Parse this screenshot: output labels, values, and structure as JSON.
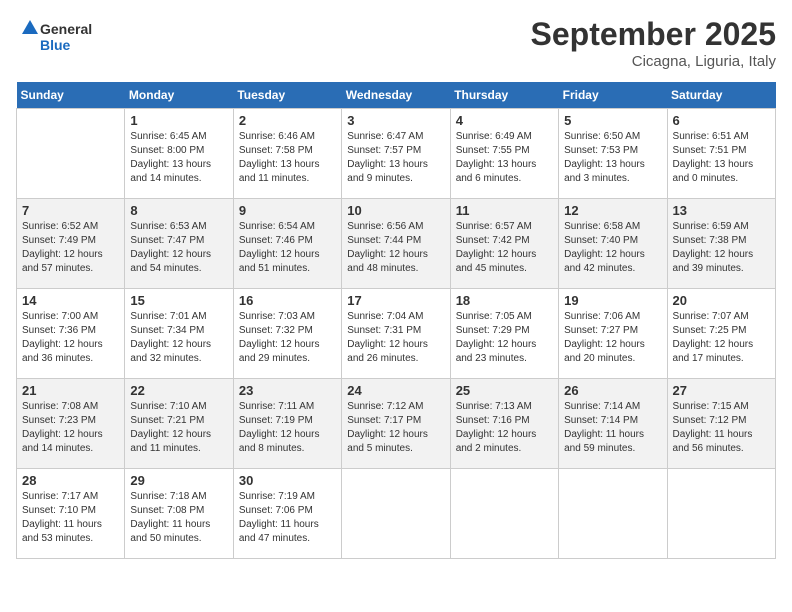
{
  "header": {
    "logo_line1": "General",
    "logo_line2": "Blue",
    "month": "September 2025",
    "location": "Cicagna, Liguria, Italy"
  },
  "weekdays": [
    "Sunday",
    "Monday",
    "Tuesday",
    "Wednesday",
    "Thursday",
    "Friday",
    "Saturday"
  ],
  "weeks": [
    [
      {
        "day": "",
        "info": ""
      },
      {
        "day": "1",
        "info": "Sunrise: 6:45 AM\nSunset: 8:00 PM\nDaylight: 13 hours\nand 14 minutes."
      },
      {
        "day": "2",
        "info": "Sunrise: 6:46 AM\nSunset: 7:58 PM\nDaylight: 13 hours\nand 11 minutes."
      },
      {
        "day": "3",
        "info": "Sunrise: 6:47 AM\nSunset: 7:57 PM\nDaylight: 13 hours\nand 9 minutes."
      },
      {
        "day": "4",
        "info": "Sunrise: 6:49 AM\nSunset: 7:55 PM\nDaylight: 13 hours\nand 6 minutes."
      },
      {
        "day": "5",
        "info": "Sunrise: 6:50 AM\nSunset: 7:53 PM\nDaylight: 13 hours\nand 3 minutes."
      },
      {
        "day": "6",
        "info": "Sunrise: 6:51 AM\nSunset: 7:51 PM\nDaylight: 13 hours\nand 0 minutes."
      }
    ],
    [
      {
        "day": "7",
        "info": "Sunrise: 6:52 AM\nSunset: 7:49 PM\nDaylight: 12 hours\nand 57 minutes."
      },
      {
        "day": "8",
        "info": "Sunrise: 6:53 AM\nSunset: 7:47 PM\nDaylight: 12 hours\nand 54 minutes."
      },
      {
        "day": "9",
        "info": "Sunrise: 6:54 AM\nSunset: 7:46 PM\nDaylight: 12 hours\nand 51 minutes."
      },
      {
        "day": "10",
        "info": "Sunrise: 6:56 AM\nSunset: 7:44 PM\nDaylight: 12 hours\nand 48 minutes."
      },
      {
        "day": "11",
        "info": "Sunrise: 6:57 AM\nSunset: 7:42 PM\nDaylight: 12 hours\nand 45 minutes."
      },
      {
        "day": "12",
        "info": "Sunrise: 6:58 AM\nSunset: 7:40 PM\nDaylight: 12 hours\nand 42 minutes."
      },
      {
        "day": "13",
        "info": "Sunrise: 6:59 AM\nSunset: 7:38 PM\nDaylight: 12 hours\nand 39 minutes."
      }
    ],
    [
      {
        "day": "14",
        "info": "Sunrise: 7:00 AM\nSunset: 7:36 PM\nDaylight: 12 hours\nand 36 minutes."
      },
      {
        "day": "15",
        "info": "Sunrise: 7:01 AM\nSunset: 7:34 PM\nDaylight: 12 hours\nand 32 minutes."
      },
      {
        "day": "16",
        "info": "Sunrise: 7:03 AM\nSunset: 7:32 PM\nDaylight: 12 hours\nand 29 minutes."
      },
      {
        "day": "17",
        "info": "Sunrise: 7:04 AM\nSunset: 7:31 PM\nDaylight: 12 hours\nand 26 minutes."
      },
      {
        "day": "18",
        "info": "Sunrise: 7:05 AM\nSunset: 7:29 PM\nDaylight: 12 hours\nand 23 minutes."
      },
      {
        "day": "19",
        "info": "Sunrise: 7:06 AM\nSunset: 7:27 PM\nDaylight: 12 hours\nand 20 minutes."
      },
      {
        "day": "20",
        "info": "Sunrise: 7:07 AM\nSunset: 7:25 PM\nDaylight: 12 hours\nand 17 minutes."
      }
    ],
    [
      {
        "day": "21",
        "info": "Sunrise: 7:08 AM\nSunset: 7:23 PM\nDaylight: 12 hours\nand 14 minutes."
      },
      {
        "day": "22",
        "info": "Sunrise: 7:10 AM\nSunset: 7:21 PM\nDaylight: 12 hours\nand 11 minutes."
      },
      {
        "day": "23",
        "info": "Sunrise: 7:11 AM\nSunset: 7:19 PM\nDaylight: 12 hours\nand 8 minutes."
      },
      {
        "day": "24",
        "info": "Sunrise: 7:12 AM\nSunset: 7:17 PM\nDaylight: 12 hours\nand 5 minutes."
      },
      {
        "day": "25",
        "info": "Sunrise: 7:13 AM\nSunset: 7:16 PM\nDaylight: 12 hours\nand 2 minutes."
      },
      {
        "day": "26",
        "info": "Sunrise: 7:14 AM\nSunset: 7:14 PM\nDaylight: 11 hours\nand 59 minutes."
      },
      {
        "day": "27",
        "info": "Sunrise: 7:15 AM\nSunset: 7:12 PM\nDaylight: 11 hours\nand 56 minutes."
      }
    ],
    [
      {
        "day": "28",
        "info": "Sunrise: 7:17 AM\nSunset: 7:10 PM\nDaylight: 11 hours\nand 53 minutes."
      },
      {
        "day": "29",
        "info": "Sunrise: 7:18 AM\nSunset: 7:08 PM\nDaylight: 11 hours\nand 50 minutes."
      },
      {
        "day": "30",
        "info": "Sunrise: 7:19 AM\nSunset: 7:06 PM\nDaylight: 11 hours\nand 47 minutes."
      },
      {
        "day": "",
        "info": ""
      },
      {
        "day": "",
        "info": ""
      },
      {
        "day": "",
        "info": ""
      },
      {
        "day": "",
        "info": ""
      }
    ]
  ]
}
